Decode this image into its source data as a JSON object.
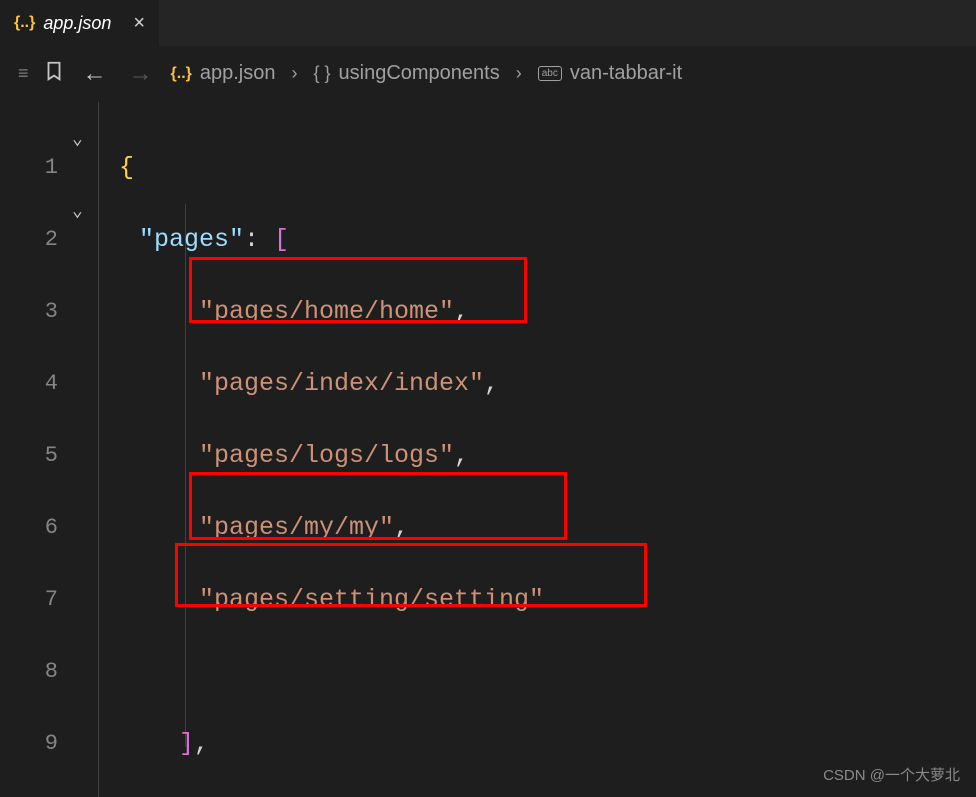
{
  "tab": {
    "icon": "{..}",
    "title": "app.json",
    "close": "×"
  },
  "breadcrumb": {
    "backArrow": "←",
    "forwardArrow": "→",
    "crumbs": [
      {
        "icon": "{..}",
        "label": "app.json"
      },
      {
        "icon": "{ }",
        "label": "usingComponents"
      },
      {
        "icon": "abc",
        "label": "van-tabbar-it"
      }
    ],
    "sep": "›"
  },
  "code": {
    "lines": [
      {
        "num": "1",
        "content": [
          {
            "t": "brace",
            "v": "{"
          }
        ]
      },
      {
        "num": "2",
        "content": [
          {
            "t": "key",
            "v": "\"pages\""
          },
          {
            "t": "colon",
            "v": ": "
          },
          {
            "t": "bracket",
            "v": "["
          }
        ]
      },
      {
        "num": "3",
        "content": [
          {
            "t": "str",
            "v": "\"pages/home/home\""
          },
          {
            "t": "comma",
            "v": ","
          }
        ]
      },
      {
        "num": "4",
        "content": [
          {
            "t": "str",
            "v": "\"pages/index/index\""
          },
          {
            "t": "comma",
            "v": ","
          }
        ]
      },
      {
        "num": "5",
        "content": [
          {
            "t": "str",
            "v": "\"pages/logs/logs\""
          },
          {
            "t": "comma",
            "v": ","
          }
        ]
      },
      {
        "num": "6",
        "content": [
          {
            "t": "str",
            "v": "\"pages/my/my\""
          },
          {
            "t": "comma",
            "v": ","
          }
        ]
      },
      {
        "num": "7",
        "content": [
          {
            "t": "str",
            "v": "\"pages/setting/setting\""
          }
        ]
      },
      {
        "num": "8",
        "content": []
      },
      {
        "num": "9",
        "content": [
          {
            "t": "bracket",
            "v": "]"
          },
          {
            "t": "comma",
            "v": ","
          }
        ]
      }
    ]
  },
  "watermark": "CSDN @一个大萝北"
}
